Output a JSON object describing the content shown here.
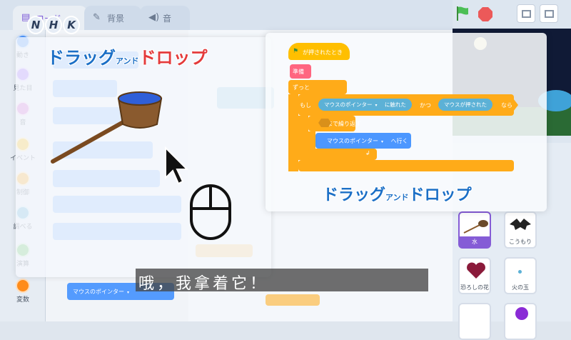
{
  "tabs": [
    {
      "label": "コード",
      "icon": "code-icon"
    },
    {
      "label": "背景",
      "icon": "brush-icon"
    },
    {
      "label": "音",
      "icon": "speaker-icon"
    }
  ],
  "categories": [
    {
      "label": "動き",
      "color": "#4c97ff"
    },
    {
      "label": "見た目",
      "color": "#9966ff"
    },
    {
      "label": "音",
      "color": "#cf63cf"
    },
    {
      "label": "イベント",
      "color": "#ffbf00"
    },
    {
      "label": "制御",
      "color": "#ffab19"
    },
    {
      "label": "調べる",
      "color": "#5cb1d6"
    },
    {
      "label": "演算",
      "color": "#59c059"
    },
    {
      "label": "変数",
      "color": "#ff8c1a"
    }
  ],
  "palette_block_text": "マウスのポインター",
  "left_card": {
    "title_part1": "ドラッグ",
    "title_small": "アンド",
    "title_part2": "ドロップ"
  },
  "right_card": {
    "title_part1": "ドラッグ",
    "title_small": "アンド",
    "title_part2": "ドロップ",
    "script": {
      "hat": "が押されたとき",
      "pink": "準備",
      "forever": "ずっと",
      "if": "もし",
      "sensing_touching": "マウスのポインター",
      "touching_suffix": "に触れた",
      "and": "かつ",
      "mouse_down": "マウスが押された",
      "then": "なら",
      "repeat_until": "まで繰り返す",
      "goto_target": "マウスのポインター",
      "goto_suffix": "へ行く"
    }
  },
  "sprites": [
    {
      "name": "水"
    },
    {
      "name": "こうもり"
    },
    {
      "name": "恐ろしの花"
    },
    {
      "name": "火の玉"
    }
  ],
  "subtitle": "哦，我拿着它！",
  "logo": [
    "N",
    "H",
    "K"
  ],
  "colors": {
    "motion": "#4c97ff",
    "control": "#ffab19",
    "events": "#ffbf00",
    "sensing": "#5cb1d6",
    "accent": "#855cd6",
    "title_blue": "#1b6fc6",
    "title_red": "#e43a3a"
  }
}
